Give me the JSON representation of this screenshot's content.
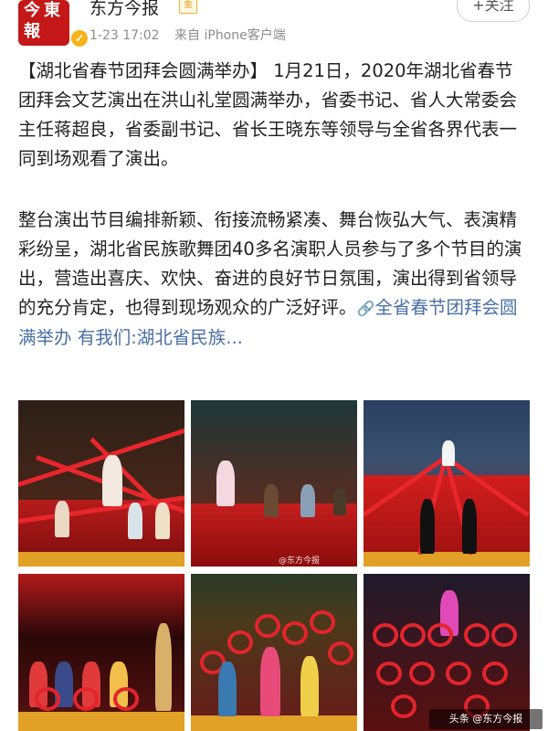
{
  "header": {
    "avatar_text": [
      "今",
      "東",
      "報"
    ],
    "account_name": "东方今报",
    "badge": "金",
    "time": "1-23 17:02",
    "source": "来自 iPhone客户端",
    "follow_label": "+关注"
  },
  "post": {
    "paragraph1": "【湖北省春节团拜会圆满举办】 1月21日，2020年湖北省春节团拜会文艺演出在洪山礼堂圆满举办，省委书记、省人大常委会主任蒋超良，省委副书记、省长王晓东等领导与全省各界代表一同到场观看了演出。",
    "paragraph2": "整台演出节目编排新颖、衔接流畅紧凑、舞台恢弘大气、表演精彩纷呈，湖北省民族歌舞团40多名演职人员参与了多个节目的演出，营造出喜庆、欢快、奋进的良好节日氛围，演出得到省领导的充分肯定，也得到现场观众的广泛好评。",
    "link_icon": "🔗",
    "link_text": "全省春节团拜会圆满举办 有我们:湖北省民族..."
  },
  "photos": {
    "watermark": "@东方今报"
  },
  "corner_tag": "头条 @东方今报"
}
